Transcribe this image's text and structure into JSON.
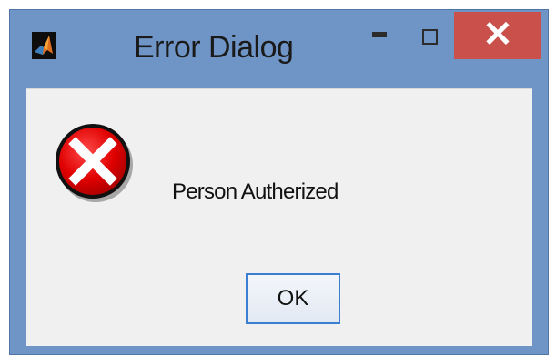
{
  "window": {
    "title": "Error Dialog",
    "icon": "matlab-logo-icon",
    "controls": {
      "minimize_icon": "minimize-icon",
      "maximize_icon": "maximize-icon",
      "close_label": "✕"
    }
  },
  "dialog": {
    "icon": "error-icon",
    "message": "Person Autherized",
    "ok_label": "OK"
  },
  "colors": {
    "frame": "#6f95c6",
    "close_button": "#c9504b",
    "client_background": "#f0f0f0",
    "error_red": "#e00000",
    "ok_border": "#3c7fd1"
  }
}
